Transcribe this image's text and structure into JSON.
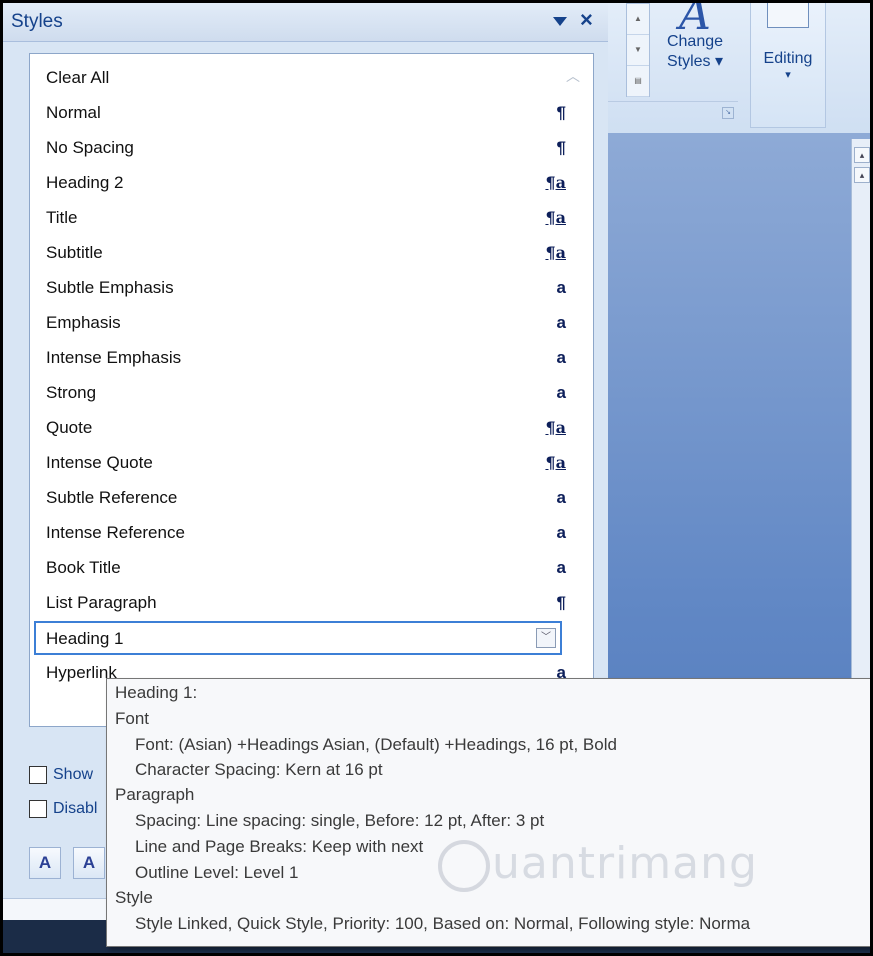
{
  "pane": {
    "title": "Styles",
    "close_glyph": "×"
  },
  "ribbon": {
    "change_styles_line1": "Change",
    "change_styles_line2": "Styles ▾",
    "editing_label": "Editing",
    "editing_arrow": "▾",
    "launcher_glyph": "↘"
  },
  "styles_list": [
    {
      "label": "Clear All",
      "mark": ""
    },
    {
      "label": "Normal",
      "mark": "¶"
    },
    {
      "label": "No Spacing",
      "mark": "¶"
    },
    {
      "label": "Heading 2",
      "mark": "¶a"
    },
    {
      "label": "Title",
      "mark": "¶a"
    },
    {
      "label": "Subtitle",
      "mark": "¶a"
    },
    {
      "label": "Subtle Emphasis",
      "mark": "a"
    },
    {
      "label": "Emphasis",
      "mark": "a"
    },
    {
      "label": "Intense Emphasis",
      "mark": "a"
    },
    {
      "label": "Strong",
      "mark": "a"
    },
    {
      "label": "Quote",
      "mark": "¶a"
    },
    {
      "label": "Intense Quote",
      "mark": "¶a"
    },
    {
      "label": "Subtle Reference",
      "mark": "a"
    },
    {
      "label": "Intense Reference",
      "mark": "a"
    },
    {
      "label": "Book Title",
      "mark": "a"
    },
    {
      "label": "List Paragraph",
      "mark": "¶"
    },
    {
      "label": "Heading 1",
      "mark": ""
    },
    {
      "label": "Hyperlink",
      "mark": "a"
    }
  ],
  "options": {
    "show_label": "Show",
    "disable_label": "Disabl"
  },
  "buttons": {
    "new_style": "A",
    "inspector": "A"
  },
  "tooltip": {
    "title": "Heading 1:",
    "font_header": "Font",
    "font_line": "Font:  (Asian) +Headings Asian, (Default) +Headings, 16 pt, Bold",
    "spacing_line": "Character Spacing:  Kern at 16 pt",
    "paragraph_header": "Paragraph",
    "para_spacing": "Spacing:  Line spacing:  single, Before:  12 pt, After:  3 pt",
    "breaks": "Line and Page Breaks:  Keep with next",
    "outline": "Outline Level:  Level 1",
    "style_header": "Style",
    "style_line": "Style Linked, Quick Style, Priority: 100, Based on: Normal, Following style: Norma"
  },
  "watermark": "uantrimang",
  "colors": {
    "accent": "#15428b",
    "selection_border": "#3c7fd6"
  }
}
